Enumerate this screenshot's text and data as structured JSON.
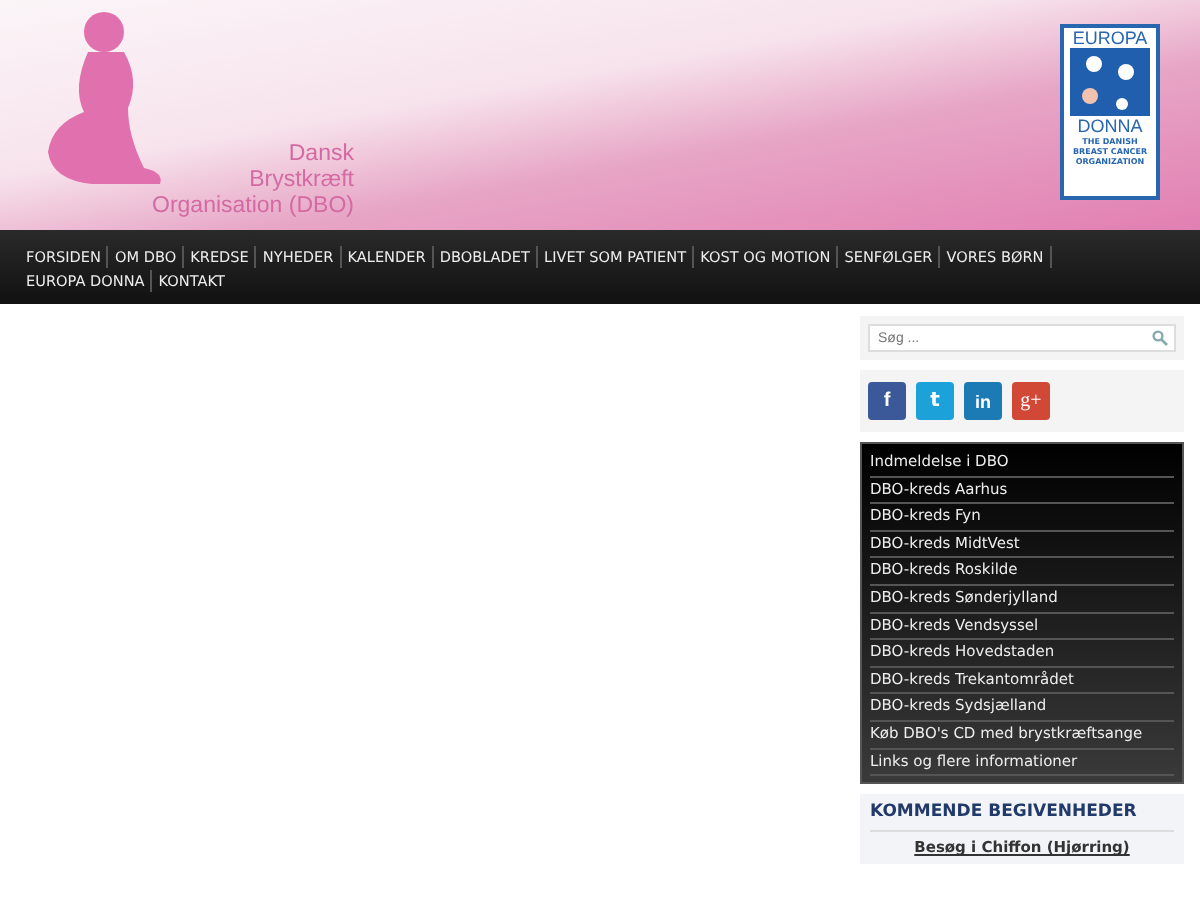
{
  "header": {
    "logo_lines": [
      "Dansk",
      "Brystkræft",
      "Organisation (DBO)"
    ],
    "partner_logo": {
      "top": "EUROPA",
      "bottom": "DONNA",
      "caption": [
        "THE DANISH",
        "BREAST CANCER",
        "ORGANIZATION"
      ]
    }
  },
  "nav": [
    "FORSIDEN",
    "OM DBO",
    "KREDSE",
    "NYHEDER",
    "KALENDER",
    "DBOBLADET",
    "LIVET SOM PATIENT",
    "KOST OG MOTION",
    "SENFØLGER",
    "VORES BØRN",
    "EUROPA DONNA",
    "KONTAKT"
  ],
  "sidebar": {
    "search": {
      "placeholder": "Søg ..."
    },
    "social": [
      {
        "kind": "facebook",
        "label": "f",
        "color": "#3b5998"
      },
      {
        "kind": "twitter",
        "label": "t",
        "color": "#1da1d9"
      },
      {
        "kind": "linkedin",
        "label": "in",
        "color": "#1c7bb5"
      },
      {
        "kind": "googleplus",
        "label": "g+",
        "color": "#d14836"
      }
    ],
    "links": [
      "Indmeldelse i DBO",
      "DBO-kreds Aarhus",
      "DBO-kreds Fyn",
      "DBO-kreds MidtVest",
      "DBO-kreds Roskilde",
      "DBO-kreds Sønderjylland",
      "DBO-kreds Vendsyssel",
      "DBO-kreds Hovedstaden",
      "DBO-kreds Trekantområdet",
      "DBO-kreds Sydsjælland",
      "Køb DBO's CD med brystkræftsange",
      "Links og flere informationer"
    ],
    "events": {
      "title": "KOMMENDE BEGIVENHEDER",
      "items": [
        "Besøg i Chiffon (Hjørring)"
      ]
    }
  }
}
